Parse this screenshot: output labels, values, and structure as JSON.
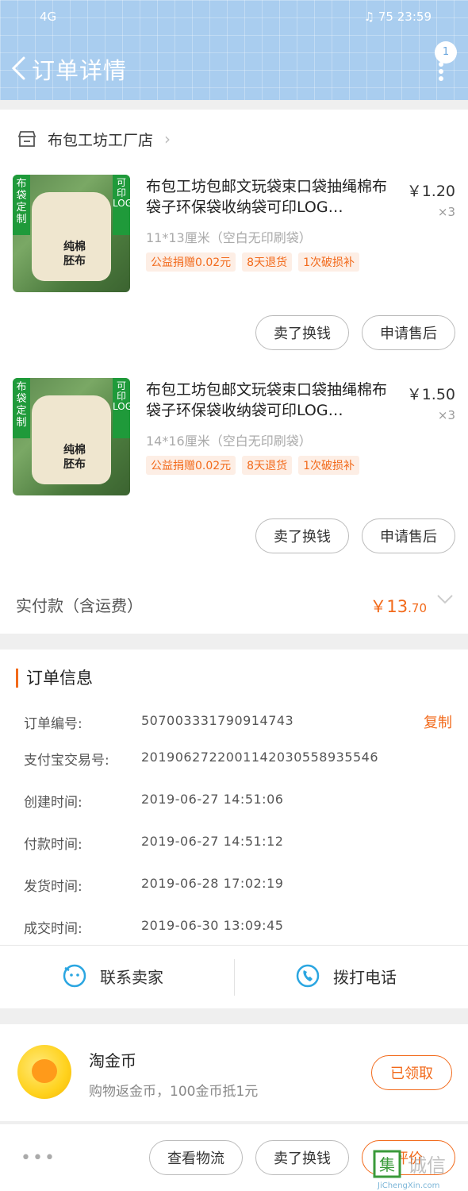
{
  "status_bar": {
    "signal": "4G",
    "battery": "75",
    "time": "23:59"
  },
  "header": {
    "title": "订单详情",
    "badge_count": "1"
  },
  "shop": {
    "name": "布包工坊工厂店"
  },
  "products": [
    {
      "title": "布包工坊包邮文玩袋束口袋抽绳棉布袋子环保袋收纳袋可印LOG…",
      "price": "￥1.20",
      "qty": "×3",
      "spec": "11*13厘米（空白无印刷袋）",
      "tags": [
        "公益捐赠0.02元",
        "8天退货",
        "1次破损补"
      ],
      "image_tag_left": "布袋定制",
      "image_tag_right": "可印LOGO",
      "image_text": "纯棉胚布",
      "btn_sell": "卖了换钱",
      "btn_service": "申请售后"
    },
    {
      "title": "布包工坊包邮文玩袋束口袋抽绳棉布袋子环保袋收纳袋可印LOG…",
      "price": "￥1.50",
      "qty": "×3",
      "spec": "14*16厘米（空白无印刷袋）",
      "tags": [
        "公益捐赠0.02元",
        "8天退货",
        "1次破损补"
      ],
      "image_tag_left": "布袋定制",
      "image_tag_right": "可印LOGO",
      "image_text": "纯棉胚布",
      "btn_sell": "卖了换钱",
      "btn_service": "申请售后"
    }
  ],
  "total": {
    "label": "实付款（含运费）",
    "currency": "￥",
    "integer": "13",
    "decimal": ".70"
  },
  "order_info": {
    "title": "订单信息",
    "copy_label": "复制",
    "rows": [
      {
        "label": "订单编号:",
        "value": "507003331790914743"
      },
      {
        "label": "支付宝交易号:",
        "value": "2019062722001142030558935546"
      },
      {
        "label": "创建时间:",
        "value": "2019-06-27 14:51:06"
      },
      {
        "label": "付款时间:",
        "value": "2019-06-27 14:51:12"
      },
      {
        "label": "发货时间:",
        "value": "2019-06-28 17:02:19"
      },
      {
        "label": "成交时间:",
        "value": "2019-06-30 13:09:45"
      }
    ]
  },
  "contact": {
    "seller": "联系卖家",
    "phone": "拨打电话"
  },
  "coins": {
    "title": "淘金币",
    "subtitle": "购物返金币，100金币抵1元",
    "button": "已领取"
  },
  "bottom_bar": {
    "logistics": "查看物流",
    "sell": "卖了换钱",
    "review": "评价"
  },
  "watermark": {
    "brand": "集诚信",
    "url": "JiChengXin.com"
  },
  "colors": {
    "accent": "#f26a1b",
    "header_bg": "#a9cdef",
    "tag_green": "#1f9a3a"
  }
}
